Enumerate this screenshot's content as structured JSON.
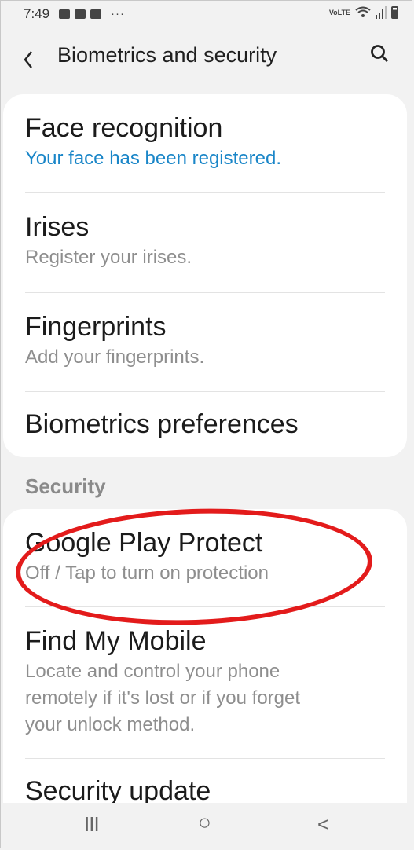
{
  "status_bar": {
    "time": "7:49",
    "more": "···",
    "volte": "VoLTE"
  },
  "header": {
    "title": "Biometrics and security"
  },
  "biometrics": {
    "items": [
      {
        "title": "Face recognition",
        "subtitle": "Your face has been registered."
      },
      {
        "title": "Irises",
        "subtitle": "Register your irises."
      },
      {
        "title": "Fingerprints",
        "subtitle": "Add your fingerprints."
      },
      {
        "title": "Biometrics preferences"
      }
    ]
  },
  "security": {
    "section_label": "Security",
    "items": [
      {
        "title": "Google Play Protect",
        "subtitle": "Off / Tap to turn on protection"
      },
      {
        "title": "Find My Mobile",
        "subtitle_lines": [
          "Locate and control your phone",
          "remotely if it's lost or if you forget",
          "your unlock method."
        ]
      },
      {
        "title": "Security update"
      }
    ]
  },
  "nav": {
    "recents": "III",
    "home": "○",
    "back": "<"
  },
  "colors": {
    "accent_blue": "#1a86c8",
    "annotation_red": "#e31b1b",
    "background": "#f2f2f2"
  }
}
